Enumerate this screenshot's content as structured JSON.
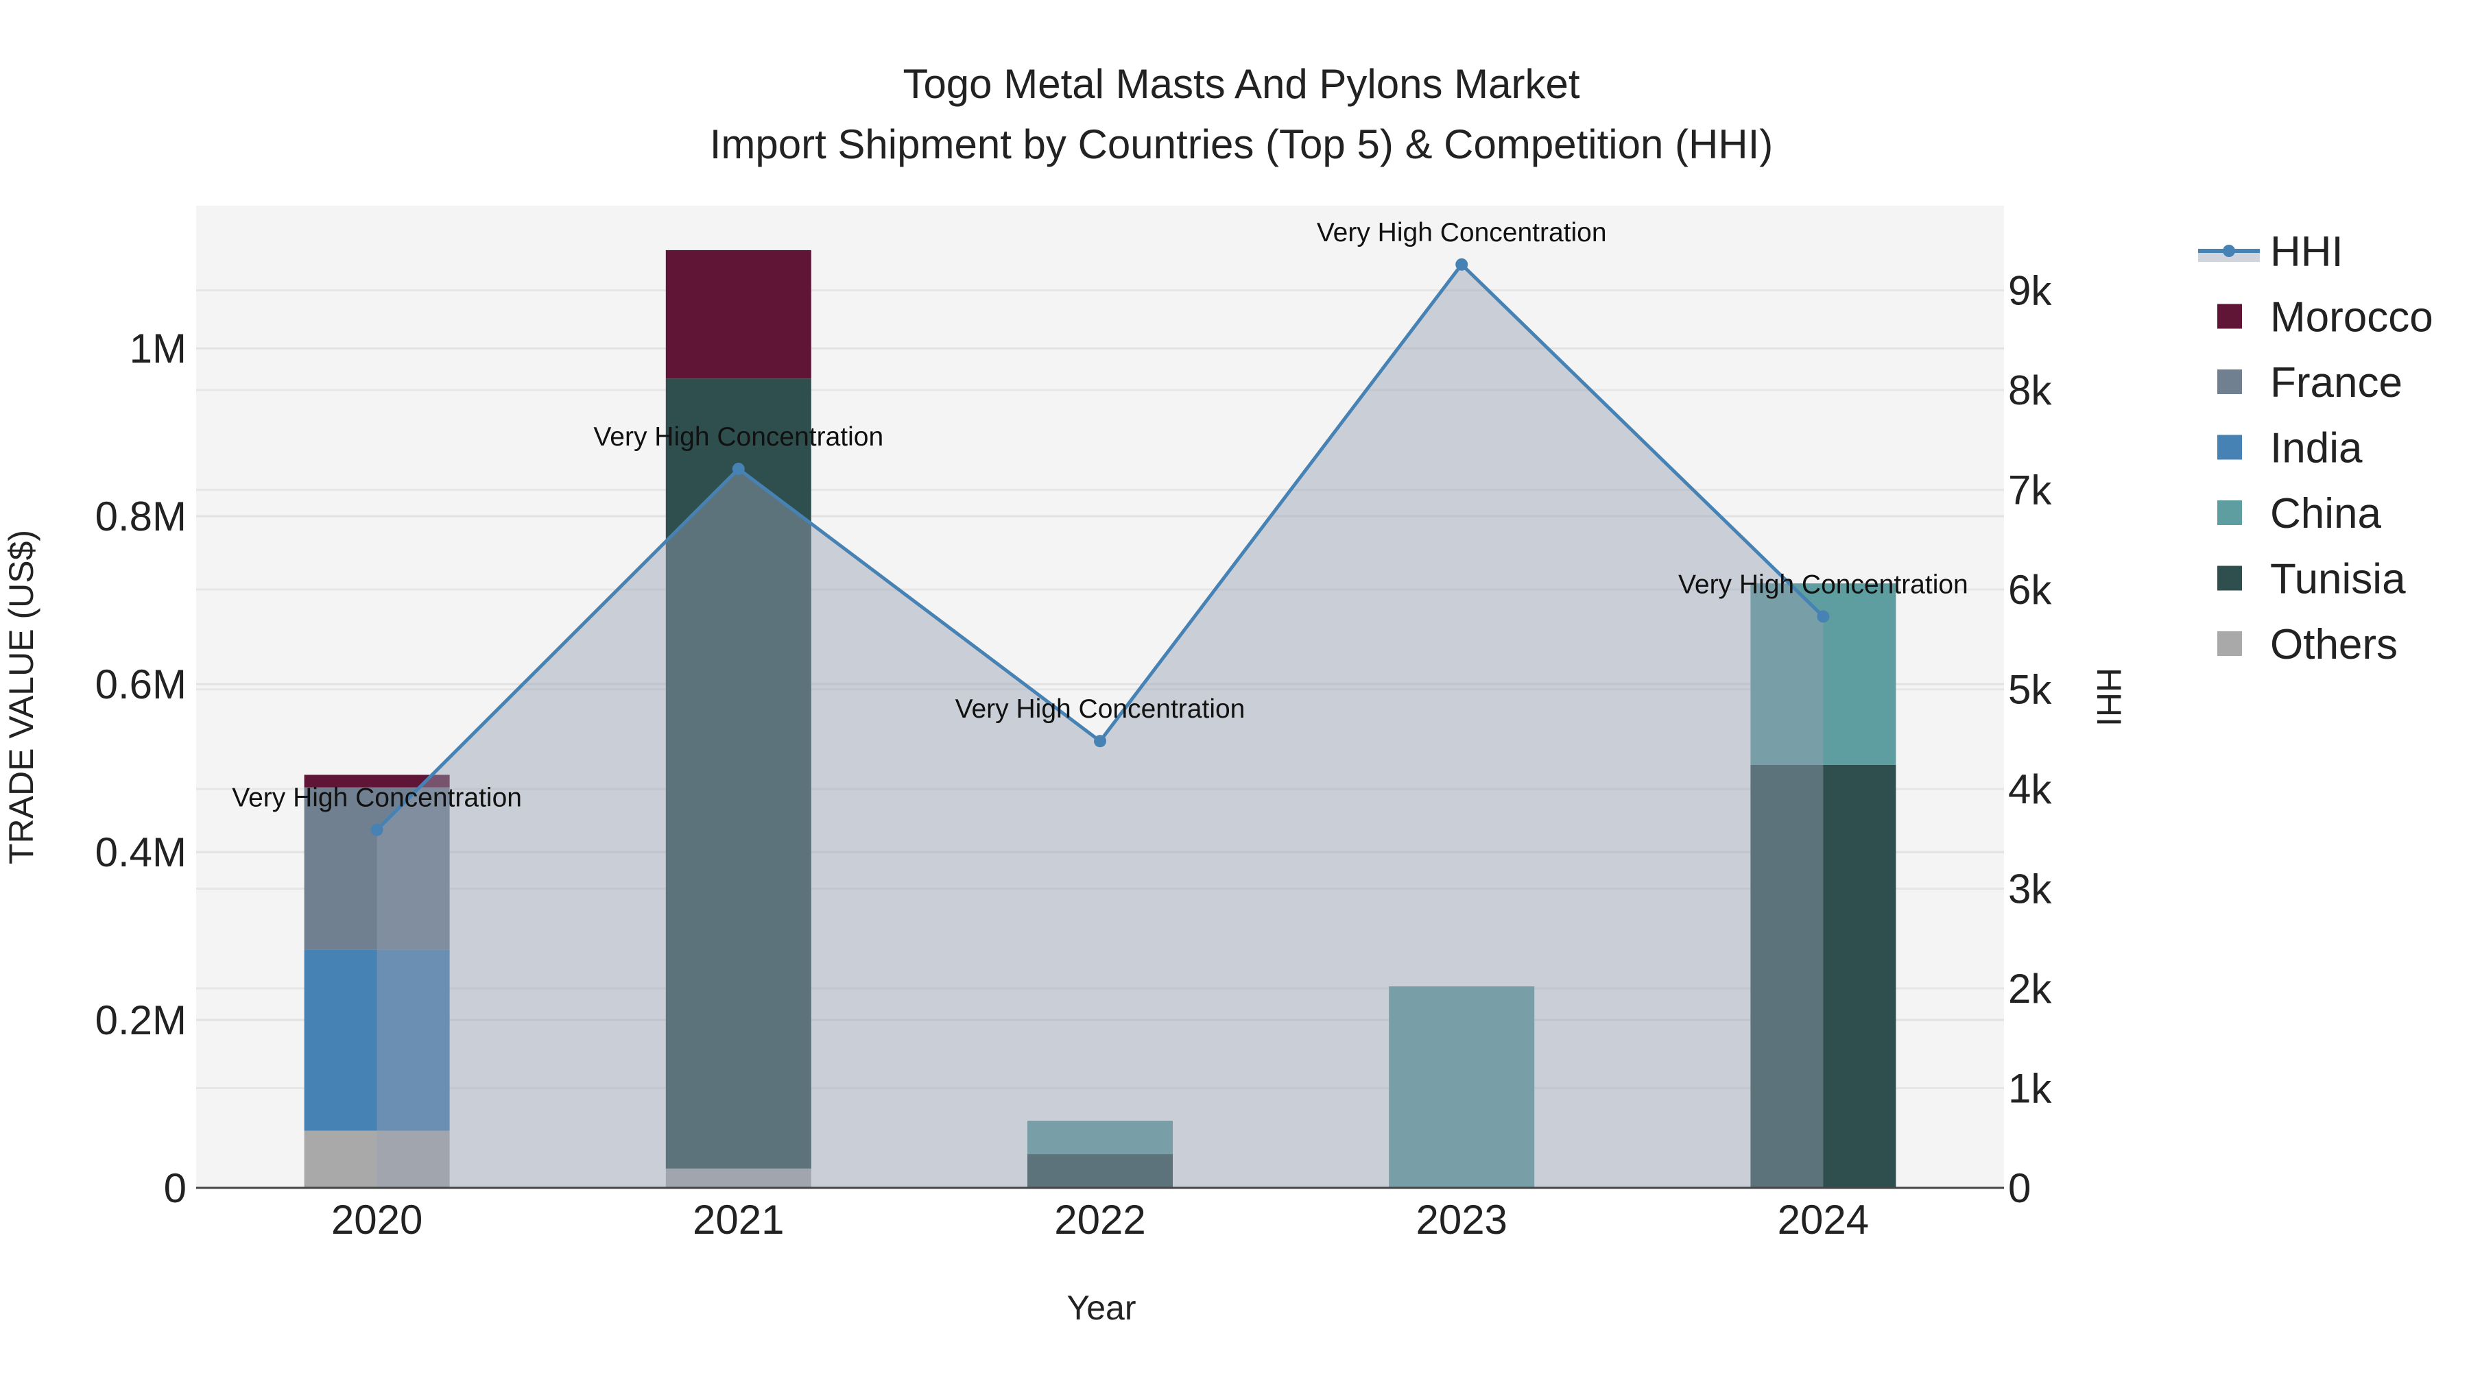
{
  "chart_data": {
    "type": "bar",
    "title": "Togo Metal Masts And Pylons Market",
    "subtitle": "Import Shipment by Countries (Top 5) & Competition (HHI)",
    "xlabel": "Year",
    "ylabel": "TRADE VALUE (US$)",
    "y2label": "HHI",
    "categories": [
      "2020",
      "2021",
      "2022",
      "2023",
      "2024"
    ],
    "ylim": [
      0,
      1170000
    ],
    "y2lim": [
      0,
      9850
    ],
    "yticks": [
      {
        "v": 0,
        "label": "0"
      },
      {
        "v": 200000,
        "label": "0.2M"
      },
      {
        "v": 400000,
        "label": "0.4M"
      },
      {
        "v": 600000,
        "label": "0.6M"
      },
      {
        "v": 800000,
        "label": "0.8M"
      },
      {
        "v": 1000000,
        "label": "1M"
      }
    ],
    "y2ticks": [
      {
        "v": 0,
        "label": "0"
      },
      {
        "v": 1000,
        "label": "1k"
      },
      {
        "v": 2000,
        "label": "2k"
      },
      {
        "v": 3000,
        "label": "3k"
      },
      {
        "v": 4000,
        "label": "4k"
      },
      {
        "v": 5000,
        "label": "5k"
      },
      {
        "v": 6000,
        "label": "6k"
      },
      {
        "v": 7000,
        "label": "7k"
      },
      {
        "v": 8000,
        "label": "8k"
      },
      {
        "v": 9000,
        "label": "9k"
      }
    ],
    "stacked": true,
    "series": [
      {
        "name": "Others",
        "color": "#a9a9a9",
        "values": [
          68000,
          23000,
          0,
          0,
          0
        ]
      },
      {
        "name": "India",
        "color": "#4682b4",
        "values": [
          216000,
          0,
          0,
          0,
          0
        ]
      },
      {
        "name": "France",
        "color": "#708090",
        "values": [
          193000,
          0,
          0,
          0,
          0
        ]
      },
      {
        "name": "Tunisia",
        "color": "#2f4f4f",
        "values": [
          0,
          941000,
          40000,
          0,
          504000
        ]
      },
      {
        "name": "China",
        "color": "#5f9ea0",
        "values": [
          0,
          0,
          40000,
          240000,
          216000
        ]
      },
      {
        "name": "Morocco",
        "color": "#601436",
        "values": [
          15000,
          153000,
          0,
          0,
          0
        ]
      }
    ],
    "hhi": {
      "name": "HHI",
      "color": "#4682b4",
      "values": [
        3590,
        7210,
        4480,
        9260,
        5730
      ]
    },
    "annotations": [
      "Very High Concentration",
      "Very High Concentration",
      "Very High Concentration",
      "Very High Concentration",
      "Very High Concentration"
    ],
    "legend": [
      "HHI",
      "Morocco",
      "France",
      "India",
      "China",
      "Tunisia",
      "Others"
    ],
    "legend_position": "right",
    "grid": true
  }
}
